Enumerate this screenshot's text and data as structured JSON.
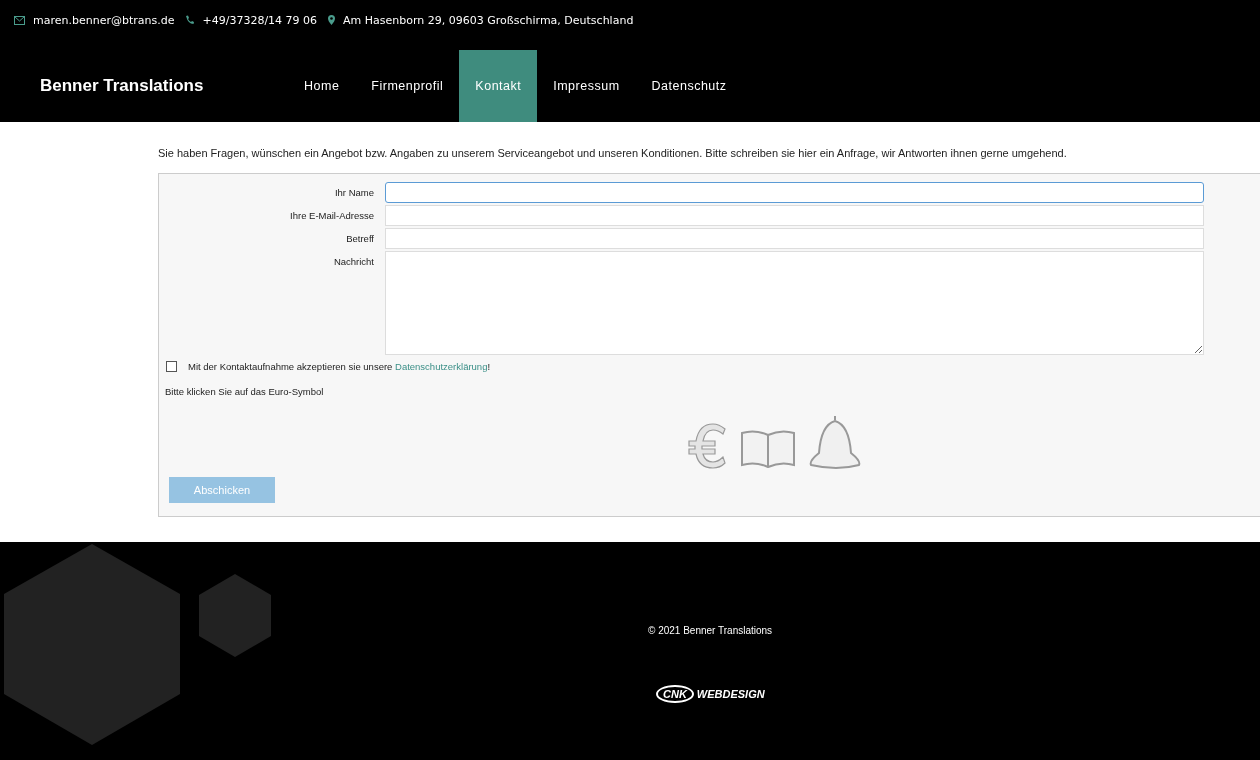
{
  "topbar": {
    "email": "maren.benner@btrans.de",
    "phone": "+49/37328/14 79 06",
    "address": "Am Hasenborn 29, 09603 Großschirma, Deutschland"
  },
  "header": {
    "brand": "Benner Translations",
    "nav": [
      {
        "label": "Home",
        "selected": false
      },
      {
        "label": "Firmenprofil",
        "selected": false
      },
      {
        "label": "Kontakt",
        "selected": true
      },
      {
        "label": "Impressum",
        "selected": false
      },
      {
        "label": "Datenschutz",
        "selected": false
      }
    ]
  },
  "intro": "Sie haben Fragen, wünschen ein Angebot bzw. Angaben zu unserem Serviceangebot und unseren Konditionen. Bitte schreiben sie hier ein Anfrage, wir Antworten ihnen gerne umgehend.",
  "form": {
    "fields": [
      {
        "label": "Ihr Name",
        "kind": "input",
        "focused": true
      },
      {
        "label": "Ihre E-Mail-Adresse",
        "kind": "input",
        "focused": false
      },
      {
        "label": "Betreff",
        "kind": "input",
        "focused": false
      },
      {
        "label": "Nachricht",
        "kind": "textarea",
        "focused": false
      }
    ],
    "consent": {
      "checked": false,
      "before": "Mit der Kontaktaufnahme akzeptieren sie unsere",
      "link": "Datenschutzerklärung",
      "after": "!"
    },
    "captcha_prompt": "Bitte klicken Sie auf das Euro-Symbol",
    "submit": "Abschicken"
  },
  "footer": {
    "copyright": "© 2021 Benner Translations",
    "logo_mark": "CNK",
    "logo_text": "WEBDESIGN"
  }
}
